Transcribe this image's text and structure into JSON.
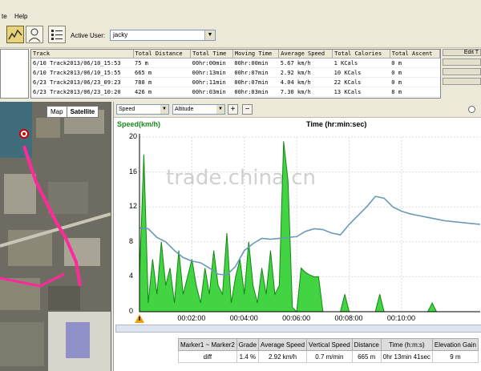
{
  "menu": {
    "items": [
      "te",
      "Help"
    ]
  },
  "toolbar": {
    "user_label": "Active User:",
    "user_value": "jacky"
  },
  "tracks": {
    "columns": [
      "Track",
      "Total Distance",
      "Total Time",
      "Moving Time",
      "Average Speed",
      "Total Calories",
      "Total Ascent"
    ],
    "rows": [
      [
        "6/10 Track2013/06/10_15:53",
        "75 m",
        "00hr:00min",
        "00hr:00min",
        "5.67 km/h",
        "1 KCals",
        "0 m"
      ],
      [
        "6/10 Track2013/06/10_15:55",
        "665 m",
        "00hr:13min",
        "00hr:07min",
        "2.92 km/h",
        "10 KCals",
        "0 m"
      ],
      [
        "6/23 Track2013/06/23_09:23",
        "788 m",
        "00hr:11min",
        "00hr:07min",
        "4.04 km/h",
        "22 KCals",
        "0 m"
      ],
      [
        "6/23 Track2013/06/23_10:20",
        "426 m",
        "00hr:03min",
        "00hr:03min",
        "7.30 km/h",
        "13 KCals",
        "8 m"
      ]
    ],
    "side_button": "Edit T"
  },
  "map": {
    "map_label": "Map",
    "satellite_label": "Satellite"
  },
  "chart_toolbar": {
    "select1": "Speed",
    "select2": "Altitude",
    "plus": "+",
    "minus": "−"
  },
  "chart_data": {
    "type": "line",
    "title_y": "Speed(km/h)",
    "title_x": "Time (hr:min:sec)",
    "yticks": [
      "20",
      "16",
      "12",
      "8",
      "4",
      "0"
    ],
    "ylim": [
      0,
      20
    ],
    "xticks": [
      "00:02:00",
      "00:04:00",
      "00:06:00",
      "00:08:00",
      "00:10:00"
    ],
    "x_range_seconds": [
      0,
      780
    ],
    "speed_color": "#22cc22",
    "altitude_color": "#6a9ab8",
    "speed": [
      [
        0,
        4
      ],
      [
        10,
        18
      ],
      [
        20,
        1
      ],
      [
        30,
        6
      ],
      [
        40,
        2
      ],
      [
        50,
        8
      ],
      [
        60,
        3
      ],
      [
        70,
        5
      ],
      [
        80,
        1
      ],
      [
        90,
        7
      ],
      [
        100,
        2
      ],
      [
        110,
        4
      ],
      [
        120,
        6
      ],
      [
        130,
        3
      ],
      [
        140,
        1
      ],
      [
        150,
        5
      ],
      [
        160,
        2
      ],
      [
        170,
        7
      ],
      [
        180,
        3
      ],
      [
        190,
        2
      ],
      [
        200,
        9
      ],
      [
        210,
        1
      ],
      [
        220,
        4
      ],
      [
        230,
        6
      ],
      [
        240,
        2
      ],
      [
        250,
        8
      ],
      [
        260,
        3
      ],
      [
        270,
        1
      ],
      [
        280,
        5
      ],
      [
        290,
        2
      ],
      [
        300,
        7
      ],
      [
        310,
        2
      ],
      [
        320,
        3
      ],
      [
        330,
        19.5
      ],
      [
        340,
        15
      ],
      [
        350,
        0.5
      ],
      [
        360,
        0
      ],
      [
        370,
        5
      ],
      [
        380,
        4.5
      ],
      [
        390,
        4.2
      ],
      [
        400,
        4
      ],
      [
        410,
        4
      ],
      [
        420,
        0
      ],
      [
        430,
        0
      ],
      [
        440,
        0
      ],
      [
        450,
        0
      ],
      [
        460,
        0
      ],
      [
        470,
        2
      ],
      [
        480,
        0
      ],
      [
        490,
        0
      ],
      [
        500,
        0
      ],
      [
        510,
        0
      ],
      [
        520,
        0
      ],
      [
        530,
        0
      ],
      [
        540,
        0
      ],
      [
        550,
        2
      ],
      [
        560,
        0
      ],
      [
        570,
        0
      ],
      [
        580,
        0
      ],
      [
        590,
        0
      ],
      [
        600,
        0
      ],
      [
        610,
        0
      ],
      [
        620,
        0
      ],
      [
        630,
        0
      ],
      [
        640,
        0
      ],
      [
        650,
        0
      ],
      [
        660,
        0
      ],
      [
        670,
        1
      ],
      [
        680,
        0
      ],
      [
        690,
        0
      ],
      [
        700,
        0
      ],
      [
        710,
        0
      ],
      [
        720,
        0
      ],
      [
        730,
        0
      ],
      [
        740,
        0
      ],
      [
        750,
        0
      ],
      [
        760,
        0
      ],
      [
        770,
        0
      ],
      [
        780,
        0
      ]
    ],
    "altitude_relative": [
      [
        0,
        9.6
      ],
      [
        20,
        9.5
      ],
      [
        40,
        8.5
      ],
      [
        60,
        8
      ],
      [
        80,
        7
      ],
      [
        100,
        6.2
      ],
      [
        120,
        5.8
      ],
      [
        140,
        5.6
      ],
      [
        160,
        5
      ],
      [
        180,
        4.3
      ],
      [
        200,
        4.2
      ],
      [
        220,
        5.2
      ],
      [
        240,
        7
      ],
      [
        260,
        7.8
      ],
      [
        280,
        8.4
      ],
      [
        300,
        8.3
      ],
      [
        320,
        8.4
      ],
      [
        340,
        8.5
      ],
      [
        360,
        8.6
      ],
      [
        380,
        9.2
      ],
      [
        400,
        9.5
      ],
      [
        420,
        9.4
      ],
      [
        440,
        9
      ],
      [
        460,
        8.8
      ],
      [
        480,
        10
      ],
      [
        500,
        11
      ],
      [
        520,
        12
      ],
      [
        540,
        13.2
      ],
      [
        560,
        13
      ],
      [
        580,
        12
      ],
      [
        600,
        11.5
      ],
      [
        620,
        11.2
      ],
      [
        640,
        11
      ],
      [
        660,
        10.8
      ],
      [
        680,
        10.6
      ],
      [
        700,
        10.4
      ],
      [
        720,
        10.3
      ],
      [
        740,
        10.2
      ],
      [
        760,
        10.1
      ],
      [
        780,
        10
      ]
    ]
  },
  "stats": {
    "headers": [
      "Marker1 ~ Marker2",
      "Grade",
      "Average Speed",
      "Vertical Speed",
      "Distance",
      "Time (h:m:s)",
      "Elevation Gain"
    ],
    "row": [
      "diff",
      "1.4 %",
      "2.92 km/h",
      "0.7 m/min",
      "665 m",
      "0hr 13min 41sec",
      "9 m"
    ]
  },
  "watermark": "trade.china.cn"
}
